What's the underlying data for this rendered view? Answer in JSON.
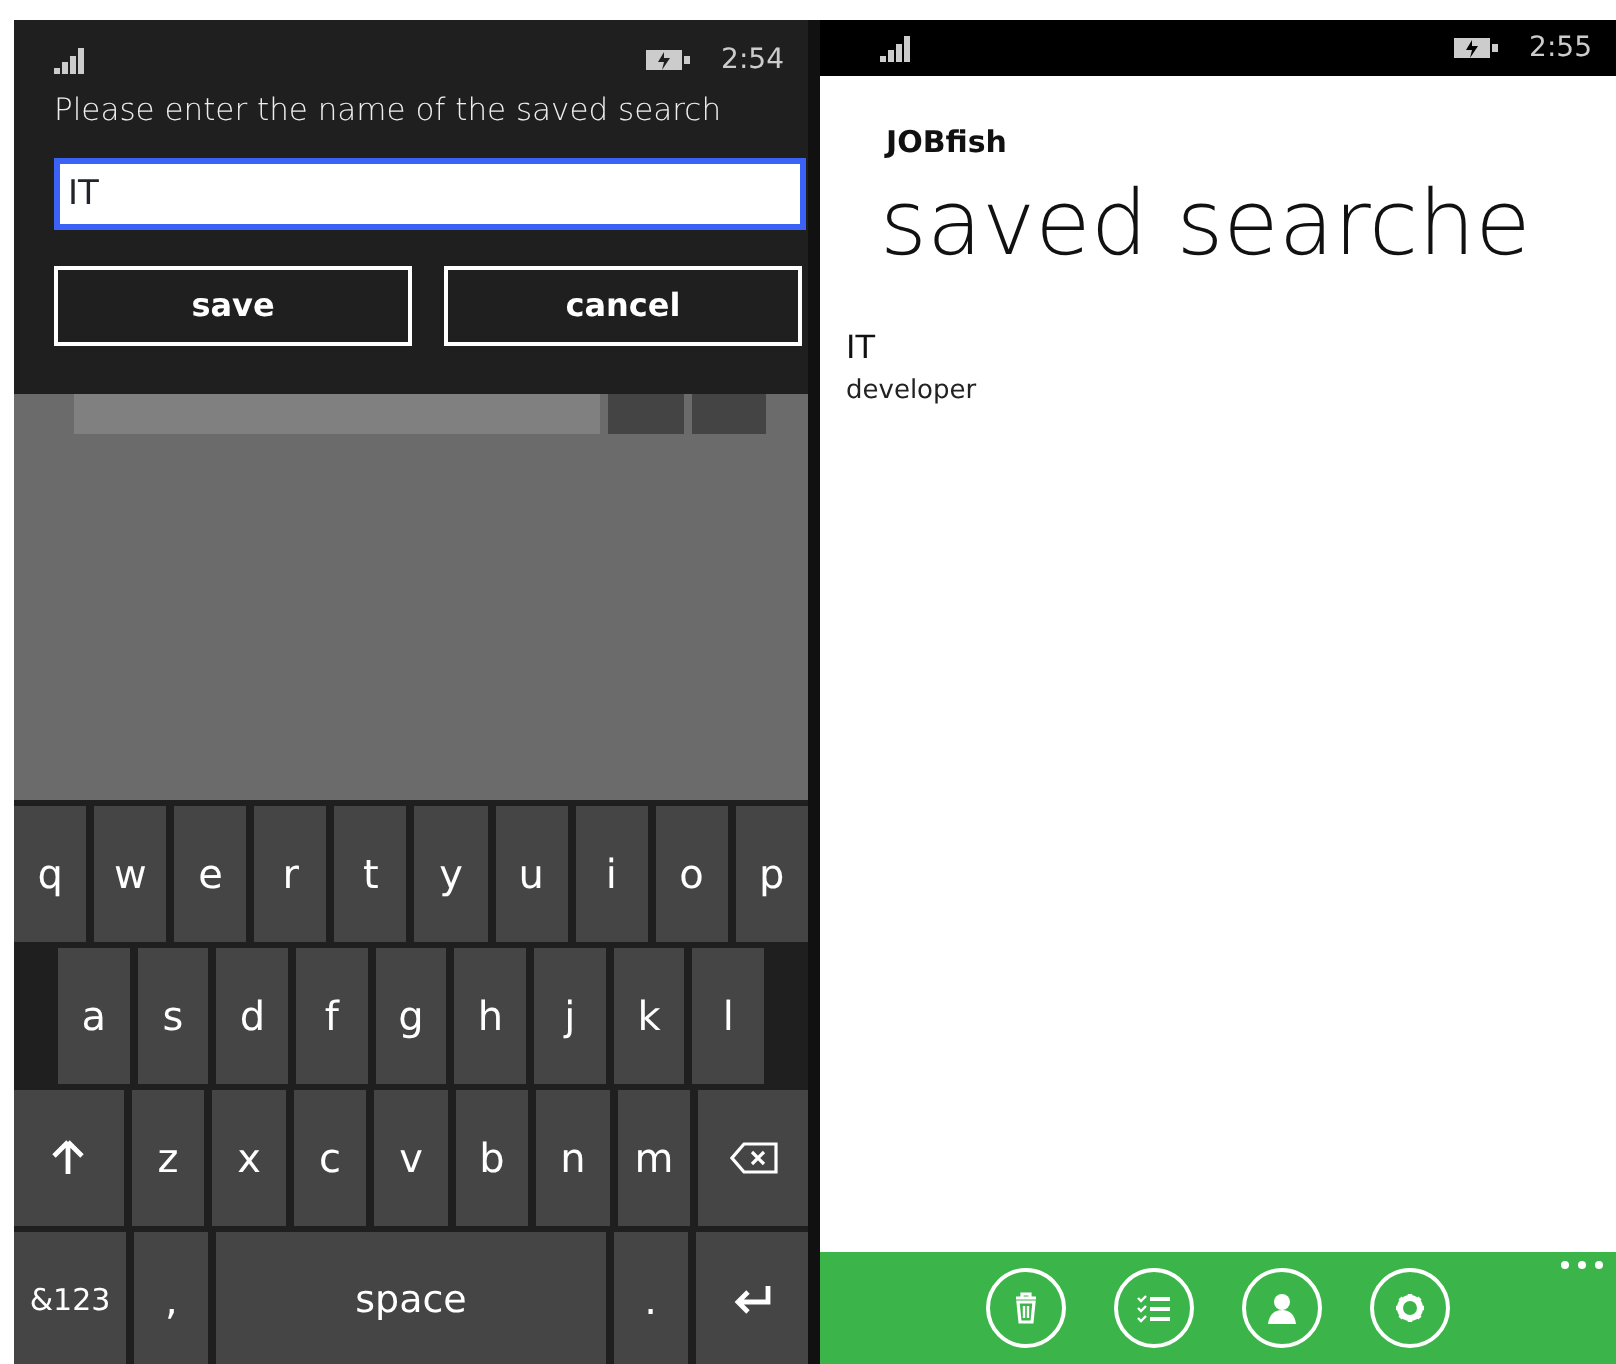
{
  "left_phone": {
    "status_bar": {
      "time": "2:54"
    },
    "dialog": {
      "prompt": "Please enter the name of the saved search",
      "name_field": {
        "value": "IT"
      },
      "buttons": [
        "save",
        "cancel"
      ]
    },
    "keyboard": {
      "rows": [
        {
          "keys": [
            {
              "kind": "letter",
              "label": "q"
            },
            {
              "kind": "letter",
              "label": "w"
            },
            {
              "kind": "letter",
              "label": "e"
            },
            {
              "kind": "letter",
              "label": "r"
            },
            {
              "kind": "letter",
              "label": "t"
            },
            {
              "kind": "letter",
              "label": "y"
            },
            {
              "kind": "letter",
              "label": "u"
            },
            {
              "kind": "letter",
              "label": "i"
            },
            {
              "kind": "letter",
              "label": "o"
            },
            {
              "kind": "letter",
              "label": "p"
            }
          ]
        },
        {
          "keys": [
            {
              "kind": "letter",
              "label": "a"
            },
            {
              "kind": "letter",
              "label": "s"
            },
            {
              "kind": "letter",
              "label": "d"
            },
            {
              "kind": "letter",
              "label": "f"
            },
            {
              "kind": "letter",
              "label": "g"
            },
            {
              "kind": "letter",
              "label": "h"
            },
            {
              "kind": "letter",
              "label": "j"
            },
            {
              "kind": "letter",
              "label": "k"
            },
            {
              "kind": "letter",
              "label": "l"
            }
          ]
        },
        {
          "keys": [
            {
              "kind": "shift"
            },
            {
              "kind": "letter",
              "label": "z"
            },
            {
              "kind": "letter",
              "label": "x"
            },
            {
              "kind": "letter",
              "label": "c"
            },
            {
              "kind": "letter",
              "label": "v"
            },
            {
              "kind": "letter",
              "label": "b"
            },
            {
              "kind": "letter",
              "label": "n"
            },
            {
              "kind": "letter",
              "label": "m"
            },
            {
              "kind": "backspace"
            }
          ]
        },
        {
          "keys": [
            {
              "kind": "symbols",
              "label": "&123"
            },
            {
              "kind": "letter",
              "label": ","
            },
            {
              "kind": "space",
              "label": "space"
            },
            {
              "kind": "letter",
              "label": "."
            },
            {
              "kind": "enter"
            }
          ]
        }
      ]
    }
  },
  "right_phone": {
    "status_bar": {
      "time": "2:55"
    },
    "app_title": "JOBfish",
    "page_title": "saved searche",
    "saved_searches": [
      {
        "title": "IT",
        "subtitle": "developer"
      }
    ],
    "app_bar": {
      "buttons": [
        {
          "kind": "delete"
        },
        {
          "kind": "list"
        },
        {
          "kind": "profile"
        },
        {
          "kind": "settings"
        }
      ]
    }
  }
}
